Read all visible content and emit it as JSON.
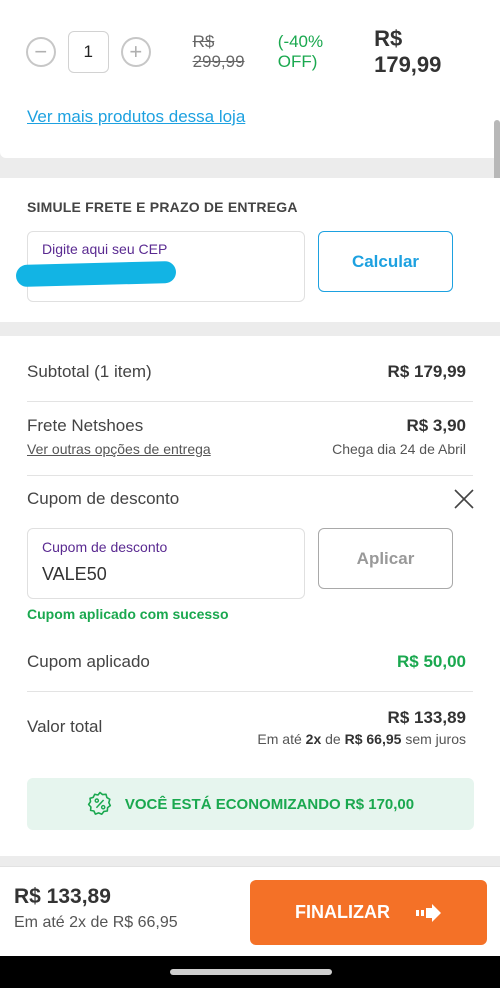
{
  "product": {
    "quantity": "1",
    "minus_symbol": "−",
    "plus_symbol": "+",
    "price_old": "R$ 299,99",
    "discount": "(-40% OFF)",
    "price_new": "R$ 179,99",
    "more_products_link": "Ver mais produtos dessa loja"
  },
  "frete": {
    "title": "SIMULE FRETE E PRAZO DE ENTREGA",
    "cep_label": "Digite aqui seu CEP",
    "calc_button": "Calcular"
  },
  "summary": {
    "subtotal_label": "Subtotal (1 item)",
    "subtotal_value": "R$ 179,99",
    "shipping_label": "Frete Netshoes",
    "shipping_value": "R$ 3,90",
    "shipping_options_link": "Ver outras opções de entrega",
    "delivery_estimate": "Chega dia 24 de Abril",
    "coupon_section_label": "Cupom de desconto",
    "coupon_field_label": "Cupom de desconto",
    "coupon_value": "VALE50",
    "apply_button": "Aplicar",
    "coupon_success": "Cupom aplicado com sucesso",
    "applied_coupon_label": "Cupom aplicado",
    "applied_coupon_value": "R$ 50,00",
    "total_label": "Valor total",
    "total_value": "R$ 133,89",
    "installments_prefix": "Em até",
    "installments_count": "2x",
    "installments_mid": "de",
    "installments_amount": "R$ 66,95",
    "installments_suffix": "sem juros",
    "savings_text": "VOCÊ ESTÁ ECONOMIZANDO R$ 170,00"
  },
  "bottom_bar": {
    "total": "R$ 133,89",
    "installments": "Em até 2x de R$ 66,95",
    "finalize_button": "FINALIZAR"
  },
  "colors": {
    "accent_blue": "#1da1e0",
    "success_green": "#1aa84f",
    "cta_orange": "#f47127",
    "label_purple": "#5a2a91"
  }
}
